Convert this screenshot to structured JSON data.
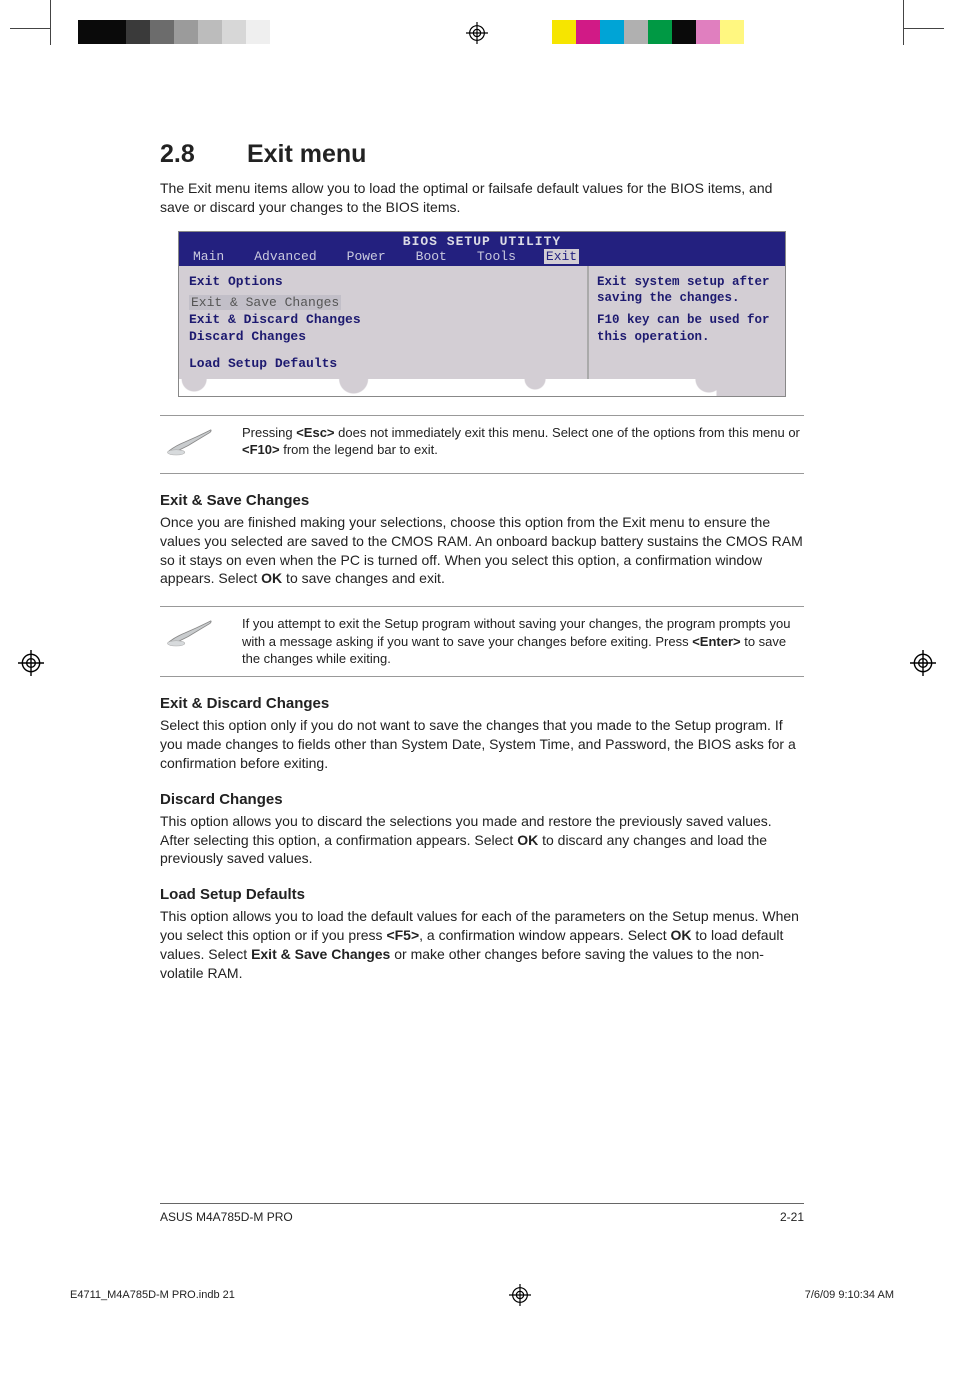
{
  "section": {
    "number": "2.8",
    "title": "Exit menu"
  },
  "intro": "The Exit menu items allow you to load the optimal or failsafe default values for the BIOS items, and save or discard your changes to the BIOS items.",
  "bios": {
    "title": "BIOS SETUP UTILITY",
    "tabs": [
      "Main",
      "Advanced",
      "Power",
      "Boot",
      "Tools",
      "Exit"
    ],
    "active_tab_index": 5,
    "panel_header": "Exit Options",
    "items": [
      {
        "label": "Exit & Save Changes",
        "selected": true
      },
      {
        "label": "Exit & Discard Changes",
        "selected": false
      },
      {
        "label": "Discard Changes",
        "selected": false
      },
      {
        "label": "Load Setup Defaults",
        "selected": false
      }
    ],
    "help_line1": "Exit system setup after saving the changes.",
    "help_line2": "F10 key can be used for this operation."
  },
  "note1": {
    "pre": "Pressing ",
    "key1": "<Esc>",
    "mid": " does not immediately exit this menu. Select one of the options from this menu or ",
    "key2": "<F10>",
    "post": " from the legend bar to exit."
  },
  "sec1": {
    "title": "Exit & Save Changes",
    "p_pre": "Once you are finished making your selections, choose this option from the Exit menu to ensure the values you selected are saved to the CMOS RAM. An onboard backup battery sustains the CMOS RAM so it stays on even when the PC is turned off. When you select this option, a confirmation window appears. Select ",
    "p_ok": "OK",
    "p_post": " to save changes and exit."
  },
  "note2": {
    "pre": " If you attempt to exit the Setup program without saving your changes, the program prompts you with a message asking if you want to save your changes before exiting. Press ",
    "key": "<Enter>",
    "post": " to save the  changes while exiting."
  },
  "sec2": {
    "title": "Exit & Discard Changes",
    "p": "Select this option only if you do not want to save the changes that you  made to the Setup program. If you made changes to fields other than System Date, System Time, and Password, the BIOS asks for a confirmation before exiting."
  },
  "sec3": {
    "title": "Discard Changes",
    "p_pre": "This option allows you to discard the selections you made and restore the previously saved values. After selecting this option, a confirmation appears. Select ",
    "p_ok": "OK",
    "p_post": " to discard any changes and load the previously saved values."
  },
  "sec4": {
    "title": "Load Setup Defaults",
    "p_pre": "This option allows you to load the default values for each of the parameters on the Setup menus. When you select this option or if you press ",
    "p_f5": "<F5>",
    "p_mid1": ", a confirmation window appears. Select ",
    "p_ok": "OK",
    "p_mid2": " to load default values. Select ",
    "p_exit": "Exit & Save Changes",
    "p_post": " or make other changes before saving the values to the non-volatile RAM."
  },
  "footer": {
    "left": "ASUS M4A785D-M PRO",
    "right": "2-21"
  },
  "print_footer": {
    "file": "E4711_M4A785D-M PRO.indb   21",
    "datetime": "7/6/09   9:10:34 AM"
  },
  "swatches_left": [
    "#0a0a0a",
    "#0a0a0a",
    "#3a3a3a",
    "#6c6c6c",
    "#9b9b9b",
    "#bcbcbc",
    "#d7d7d7",
    "#efefef"
  ],
  "swatches_right": [
    "#f6e500",
    "#d11a86",
    "#00a4d6",
    "#b0b0b0",
    "#009944",
    "#0a0a0a",
    "#e07fbf",
    "#fff780"
  ]
}
